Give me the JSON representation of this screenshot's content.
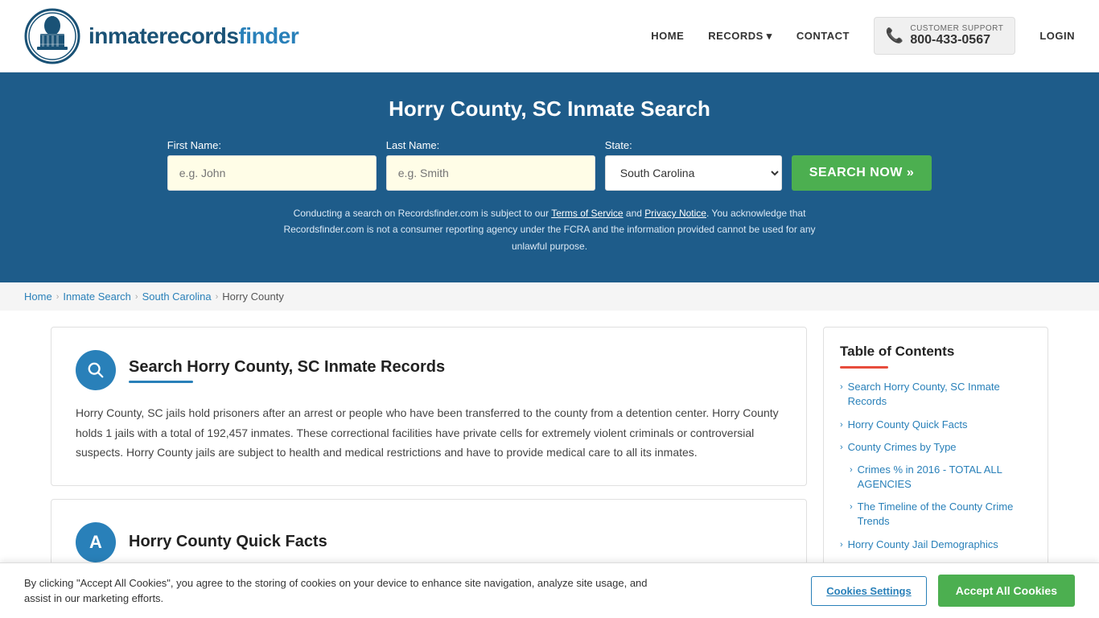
{
  "site": {
    "logo_text_prefix": "inmaterecords",
    "logo_text_suffix": "finder",
    "logo_alt": "InmateRecordsFinder Logo"
  },
  "nav": {
    "home_label": "HOME",
    "records_label": "RECORDS",
    "contact_label": "CONTACT",
    "customer_support_label": "CUSTOMER SUPPORT",
    "phone_number": "800-433-0567",
    "login_label": "LOGIN"
  },
  "hero": {
    "title": "Horry County, SC Inmate Search",
    "first_name_label": "First Name:",
    "first_name_placeholder": "e.g. John",
    "last_name_label": "Last Name:",
    "last_name_placeholder": "e.g. Smith",
    "state_label": "State:",
    "state_value": "South Carolina",
    "search_btn_label": "SEARCH NOW »",
    "disclaimer": "Conducting a search on Recordsfinder.com is subject to our Terms of Service and Privacy Notice. You acknowledge that Recordsfinder.com is not a consumer reporting agency under the FCRA and the information provided cannot be used for any unlawful purpose.",
    "terms_label": "Terms of Service",
    "privacy_label": "Privacy Notice"
  },
  "breadcrumb": {
    "home": "Home",
    "inmate_search": "Inmate Search",
    "south_carolina": "South Carolina",
    "current": "Horry County"
  },
  "main": {
    "section1": {
      "title": "Search Horry County, SC Inmate Records",
      "icon": "🔍",
      "body": "Horry County, SC jails hold prisoners after an arrest or people who have been transferred to the county from a detention center. Horry County holds 1 jails with a total of 192,457 inmates. These correctional facilities have private cells for extremely violent criminals or controversial suspects. Horry County jails are subject to health and medical restrictions and have to provide medical care to all its inmates."
    },
    "section2": {
      "title": "Horry County Quick Facts",
      "icon": "A"
    }
  },
  "toc": {
    "title": "Table of Contents",
    "items": [
      {
        "label": "Search Horry County, SC Inmate Records",
        "sub": false
      },
      {
        "label": "Horry County Quick Facts",
        "sub": false
      },
      {
        "label": "County Crimes by Type",
        "sub": false
      },
      {
        "label": "Crimes % in 2016 - TOTAL ALL AGENCIES",
        "sub": true
      },
      {
        "label": "The Timeline of the County Crime Trends",
        "sub": true
      },
      {
        "label": "Horry County Jail Demographics",
        "sub": false
      }
    ]
  },
  "cookie_banner": {
    "text": "By clicking \"Accept All Cookies\", you agree to the storing of cookies on your device to enhance site navigation, analyze site usage, and assist in our marketing efforts.",
    "settings_label": "Cookies Settings",
    "accept_label": "Accept All Cookies"
  }
}
